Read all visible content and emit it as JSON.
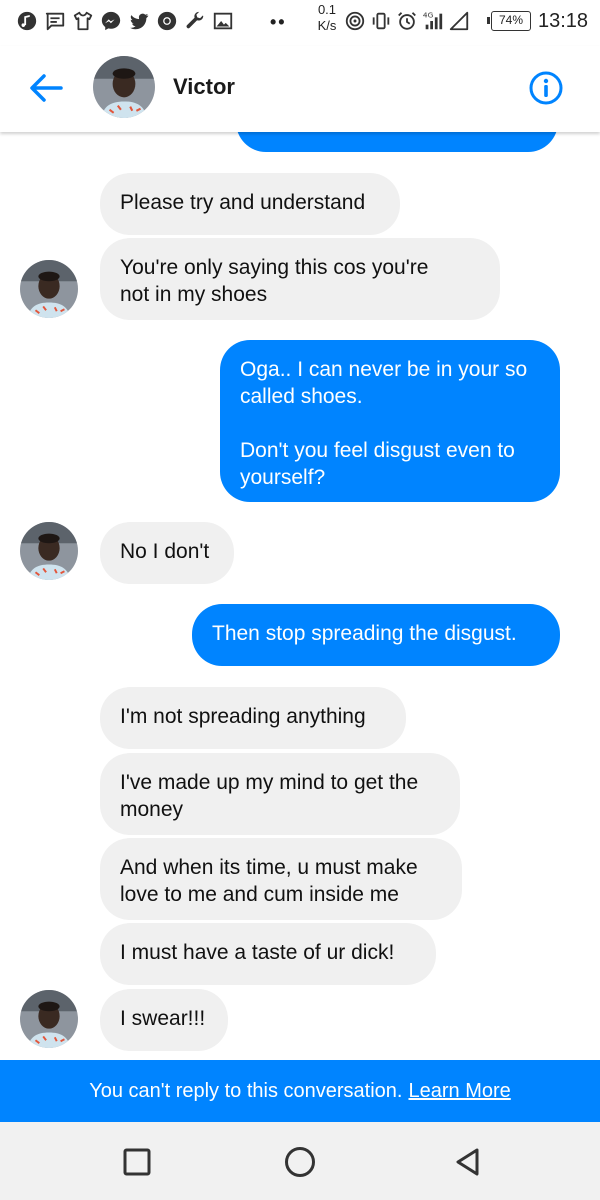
{
  "status_bar": {
    "left_icons": [
      "music-icon",
      "message-icon",
      "shirt-icon",
      "messenger-icon",
      "twitter-icon",
      "chrome-icon",
      "wrench-icon",
      "image-icon"
    ],
    "dots": "••",
    "speed_value": "0.1",
    "speed_unit": "K/s",
    "network_label": "4G",
    "battery": "74%",
    "time": "13:18"
  },
  "header": {
    "contact_name": "Victor"
  },
  "messages": [
    {
      "side": "out",
      "text": ""
    },
    {
      "side": "in",
      "text": "Please try and understand"
    },
    {
      "side": "in",
      "text": "You're only saying this cos you're\nnot in my shoes"
    },
    {
      "side": "out",
      "text": "Oga.. I can never be in your so\ncalled shoes.\n\nDon't you feel disgust even to\nyourself?"
    },
    {
      "side": "in",
      "text": "No I don't"
    },
    {
      "side": "out",
      "text": "Then stop spreading the disgust."
    },
    {
      "side": "in",
      "text": "I'm not spreading anything"
    },
    {
      "side": "in",
      "text": "I've made up my mind to get the\nmoney"
    },
    {
      "side": "in",
      "text": "And when its time, u must make\nlove to me and cum inside me"
    },
    {
      "side": "in",
      "text": "I must have a taste of ur dick!"
    },
    {
      "side": "in",
      "text": "I swear!!!"
    }
  ],
  "footer": {
    "text": "You can't reply to this conversation.",
    "link": "Learn More"
  },
  "colors": {
    "accent": "#0084ff",
    "incoming_bubble": "#f0f0f0",
    "footer_bg": "#0084ff",
    "nav_bg": "#f1f1f1"
  },
  "navbar": {
    "buttons": [
      "recents-square-icon",
      "home-circle-icon",
      "back-triangle-icon"
    ]
  }
}
